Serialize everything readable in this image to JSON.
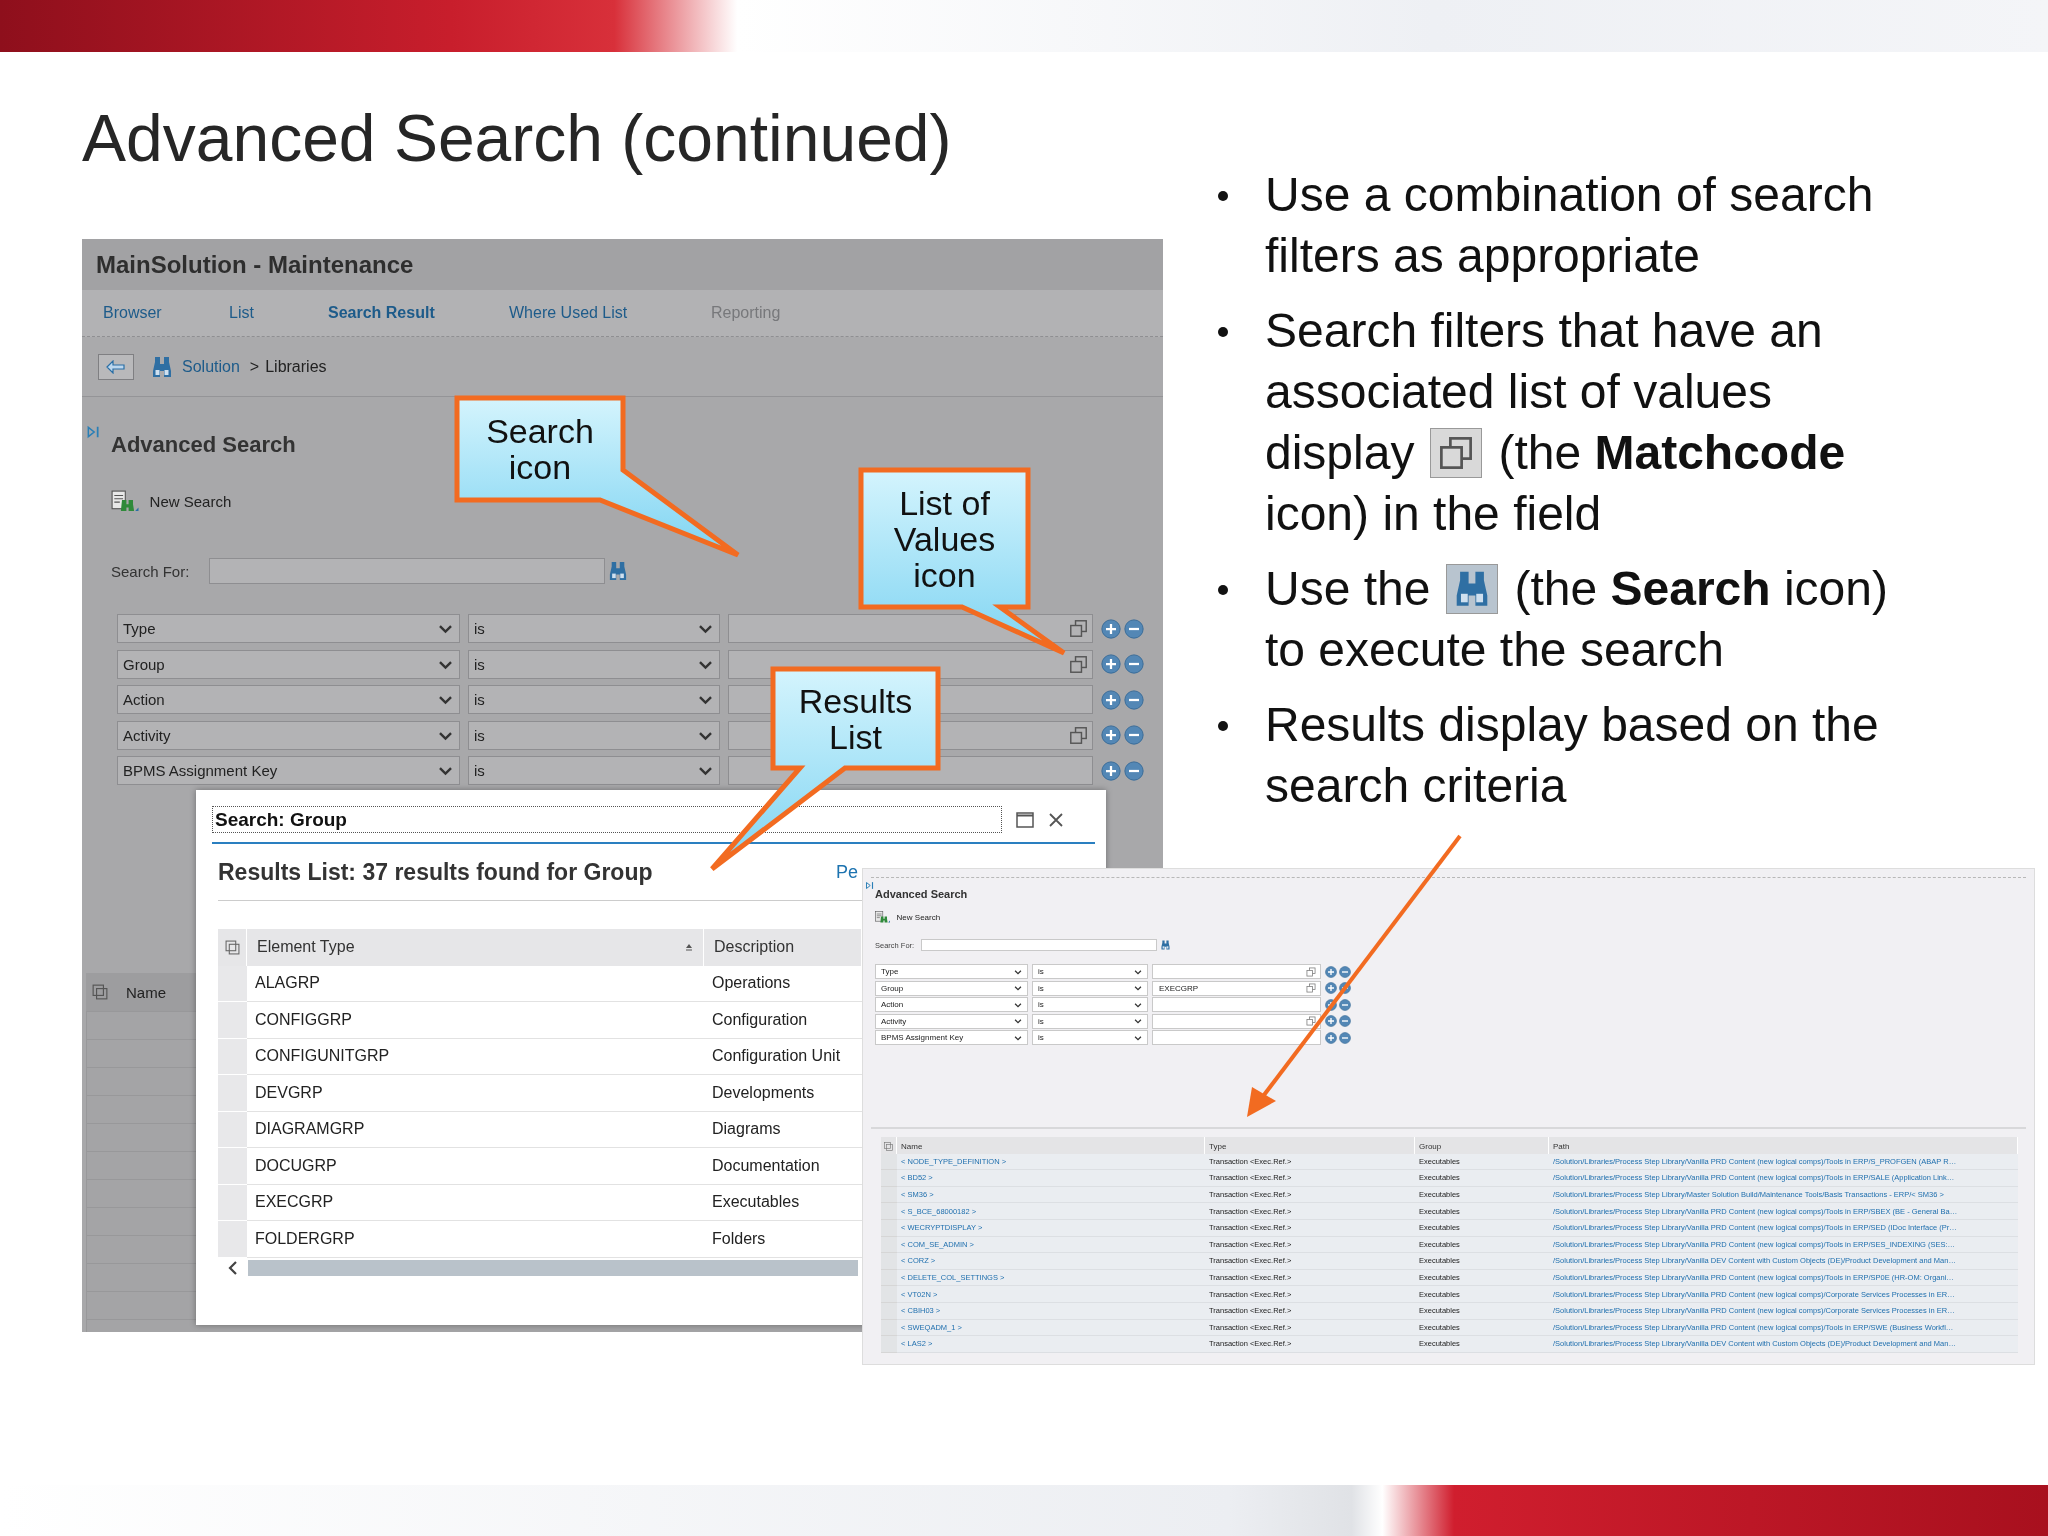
{
  "slide_title": "Advanced Search (continued)",
  "main_window": {
    "title": "MainSolution - Maintenance",
    "tabs": [
      {
        "label": "Browser",
        "selected": false,
        "disabled": false
      },
      {
        "label": "List",
        "selected": false,
        "disabled": false
      },
      {
        "label": "Search Result",
        "selected": true,
        "disabled": false
      },
      {
        "label": "Where Used List",
        "selected": false,
        "disabled": false
      },
      {
        "label": "Reporting",
        "selected": false,
        "disabled": true
      }
    ],
    "breadcrumb": {
      "link": "Solution",
      "separator": ">",
      "current": "Libraries"
    },
    "panel_title": "Advanced Search",
    "new_search": "New Search",
    "search_label": "Search For:",
    "filters": [
      {
        "field": "Type",
        "operator": "is",
        "matchcode": true
      },
      {
        "field": "Group",
        "operator": "is",
        "matchcode": true
      },
      {
        "field": "Action",
        "operator": "is",
        "matchcode": false
      },
      {
        "field": "Activity",
        "operator": "is",
        "matchcode": true
      },
      {
        "field": "BPMS Assignment Key",
        "operator": "is",
        "matchcode": false
      }
    ],
    "table": {
      "columns": [
        "Name"
      ]
    }
  },
  "dialog": {
    "title": "Search: Group",
    "heading": "Results List: 37 results found for Group",
    "link": "Pe",
    "columns": [
      "Element Type",
      "Description"
    ],
    "rows": [
      {
        "element_type": "ALAGRP",
        "description": "Operations"
      },
      {
        "element_type": "CONFIGGRP",
        "description": "Configuration"
      },
      {
        "element_type": "CONFIGUNITGRP",
        "description": "Configuration Unit"
      },
      {
        "element_type": "DEVGRP",
        "description": "Developments"
      },
      {
        "element_type": "DIAGRAMGRP",
        "description": "Diagrams"
      },
      {
        "element_type": "DOCUGRP",
        "description": "Documentation"
      },
      {
        "element_type": "EXECGRP",
        "description": "Executables"
      },
      {
        "element_type": "FOLDERGRP",
        "description": "Folders"
      }
    ]
  },
  "callouts": [
    {
      "text": "Search icon"
    },
    {
      "text": "List of Values icon"
    },
    {
      "text": "Results List"
    }
  ],
  "bullets": [
    {
      "kind": "plain",
      "text": "Use a combination of search filters as appropriate"
    },
    {
      "kind": "matchcode",
      "text": "Search filters that have an associated list of values",
      "before": "display",
      "after": "(the **Matchcode**",
      "rest": "icon) in the field"
    },
    {
      "kind": "search",
      "before": "Use the",
      "after": "(the **Search** icon)",
      "rest": "to execute the search"
    },
    {
      "kind": "plain",
      "text": "Results display based on the search criteria"
    }
  ],
  "result_window": {
    "panel_title": "Advanced Search",
    "new_search": "New Search",
    "search_label": "Search For:",
    "filters": [
      {
        "field": "Type",
        "operator": "is",
        "matchcode": true
      },
      {
        "field": "Group",
        "operator": "is",
        "value": "EXECGRP",
        "matchcode": true
      },
      {
        "field": "Action",
        "operator": "is",
        "matchcode": false
      },
      {
        "field": "Activity",
        "operator": "is",
        "matchcode": true
      },
      {
        "field": "BPMS Assignment Key",
        "operator": "is",
        "matchcode": false
      }
    ],
    "columns": [
      "Name",
      "Type",
      "Group",
      "Path"
    ],
    "rows": [
      {
        "name": "< NODE_TYPE_DEFINITION >",
        "type": "Transaction <Exec.Ref.>",
        "group": "Executables",
        "path": "/Solution/Libraries/Process Step Library/Vanilla PRD Content (new logical comps)/Tools in ERP/S_PROFGEN (ABAP R…"
      },
      {
        "name": "< BD52 >",
        "type": "Transaction <Exec.Ref.>",
        "group": "Executables",
        "path": "/Solution/Libraries/Process Step Library/Vanilla PRD Content (new logical comps)/Tools in ERP/SALE (Application Link…"
      },
      {
        "name": "< SM36 >",
        "type": "Transaction <Exec.Ref.>",
        "group": "Executables",
        "path": "/Solution/Libraries/Process Step Library/Master Solution Build/Maintenance Tools/Basis Transactions - ERP/< SM36 >"
      },
      {
        "name": "< S_BCE_68000182 >",
        "type": "Transaction <Exec.Ref.>",
        "group": "Executables",
        "path": "/Solution/Libraries/Process Step Library/Vanilla PRD Content (new logical comps)/Tools in ERP/SBEX (BE - General Ba…"
      },
      {
        "name": "< WECRYPTDISPLAY >",
        "type": "Transaction <Exec.Ref.>",
        "group": "Executables",
        "path": "/Solution/Libraries/Process Step Library/Vanilla PRD Content (new logical comps)/Tools in ERP/SED (IDoc Interface (Pr…"
      },
      {
        "name": "< COM_SE_ADMIN >",
        "type": "Transaction <Exec.Ref.>",
        "group": "Executables",
        "path": "/Solution/Libraries/Process Step Library/Vanilla PRD Content (new logical comps)/Tools in ERP/SES_INDEXING (SES:…"
      },
      {
        "name": "< CORZ >",
        "type": "Transaction <Exec.Ref.>",
        "group": "Executables",
        "path": "/Solution/Libraries/Process Step Library/Vanilla DEV Content with Custom Objects (DE)/Product Development and Man…"
      },
      {
        "name": "< DELETE_COL_SETTINGS >",
        "type": "Transaction <Exec.Ref.>",
        "group": "Executables",
        "path": "/Solution/Libraries/Process Step Library/Vanilla PRD Content (new logical comps)/Tools in ERP/SP0E (HR-OM: Organi…"
      },
      {
        "name": "< VT02N >",
        "type": "Transaction <Exec.Ref.>",
        "group": "Executables",
        "path": "/Solution/Libraries/Process Step Library/Vanilla PRD Content (new logical comps)/Corporate Services Processes in ER…"
      },
      {
        "name": "< CBIH03 >",
        "type": "Transaction <Exec.Ref.>",
        "group": "Executables",
        "path": "/Solution/Libraries/Process Step Library/Vanilla PRD Content (new logical comps)/Corporate Services Processes in ER…"
      },
      {
        "name": "< SWEQADM_1 >",
        "type": "Transaction <Exec.Ref.>",
        "group": "Executables",
        "path": "/Solution/Libraries/Process Step Library/Vanilla PRD Content (new logical comps)/Tools in ERP/SWE (Business Workfl…"
      },
      {
        "name": "< LAS2 >",
        "type": "Transaction <Exec.Ref.>",
        "group": "Executables",
        "path": "/Solution/Libraries/Process Step Library/Vanilla DEV Content with Custom Objects (DE)/Product Development and Man…"
      }
    ]
  }
}
